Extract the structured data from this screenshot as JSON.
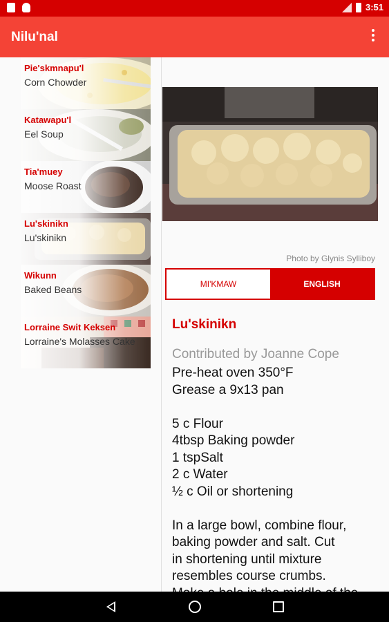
{
  "status_bar": {
    "time": "3:51"
  },
  "app_bar": {
    "title": "Nilu'nal"
  },
  "recipes": [
    {
      "name": "Pie'skmnapu'l",
      "english": "Corn Chowder"
    },
    {
      "name": "Katawapu'l",
      "english": "Eel Soup"
    },
    {
      "name": "Tia'muey",
      "english": "Moose Roast"
    },
    {
      "name": "Lu'skinikn",
      "english": "Lu'skinikn"
    },
    {
      "name": "Wikunn",
      "english": "Baked Beans"
    },
    {
      "name": "Lorraine Swit Keksen",
      "english": "Lorraine's Molasses Cake"
    }
  ],
  "detail": {
    "photo_credit": "Photo by Glynis Sylliboy",
    "language_options": [
      "MI'KMAW",
      "ENGLISH"
    ],
    "selected_language": "ENGLISH",
    "title": "Lu'skinikn",
    "contributor": "Contributed by Joanne Cope",
    "body_lines": [
      "Pre-heat oven 350°F",
      "Grease a 9x13 pan",
      "",
      "5 c  Flour",
      "4tbsp Baking powder",
      "1 tspSalt",
      "2 c  Water",
      "½ c   Oil or shortening",
      "",
      "In a large bowl, combine flour,",
      "baking powder and salt.  Cut",
      "in shortening until mixture",
      "resembles course crumbs.",
      "Make a hole in the middle of the"
    ]
  },
  "icons": {
    "menu": "overflow-menu-icon",
    "nav_back": "back-icon",
    "nav_home": "home-icon",
    "nav_recent": "recent-apps-icon"
  },
  "colors": {
    "status_bar": "#d50000",
    "app_bar": "#f44336",
    "accent": "#d50000"
  }
}
